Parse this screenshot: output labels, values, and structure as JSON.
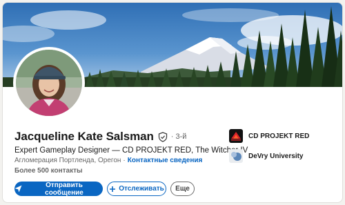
{
  "profile": {
    "name": "Jacqueline Kate Salsman",
    "degree": "· 3-й",
    "headline": "Expert Gameplay Designer — CD PROJEKT RED, The Witcher IV",
    "location": "Агломерация Портленда, Орегон",
    "location_separator": "·",
    "contact_link": "Контактные сведения",
    "connections": "Более 500 контакты"
  },
  "actions": {
    "message_label": "Отправить сообщение",
    "follow_label": "Отслеживать",
    "more_label": "Еще"
  },
  "organizations": [
    {
      "name": "CD PROJEKT RED",
      "logo": "cd-projekt-red-logo"
    },
    {
      "name": "DeVry University",
      "logo": "devry-university-logo"
    }
  ],
  "icons": {
    "verified": "verified-shield-icon",
    "send": "paper-plane-icon",
    "follow": "plus-icon"
  },
  "colors": {
    "accent": "#0a66c2",
    "text_primary": "#191919",
    "text_secondary": "#666666"
  }
}
